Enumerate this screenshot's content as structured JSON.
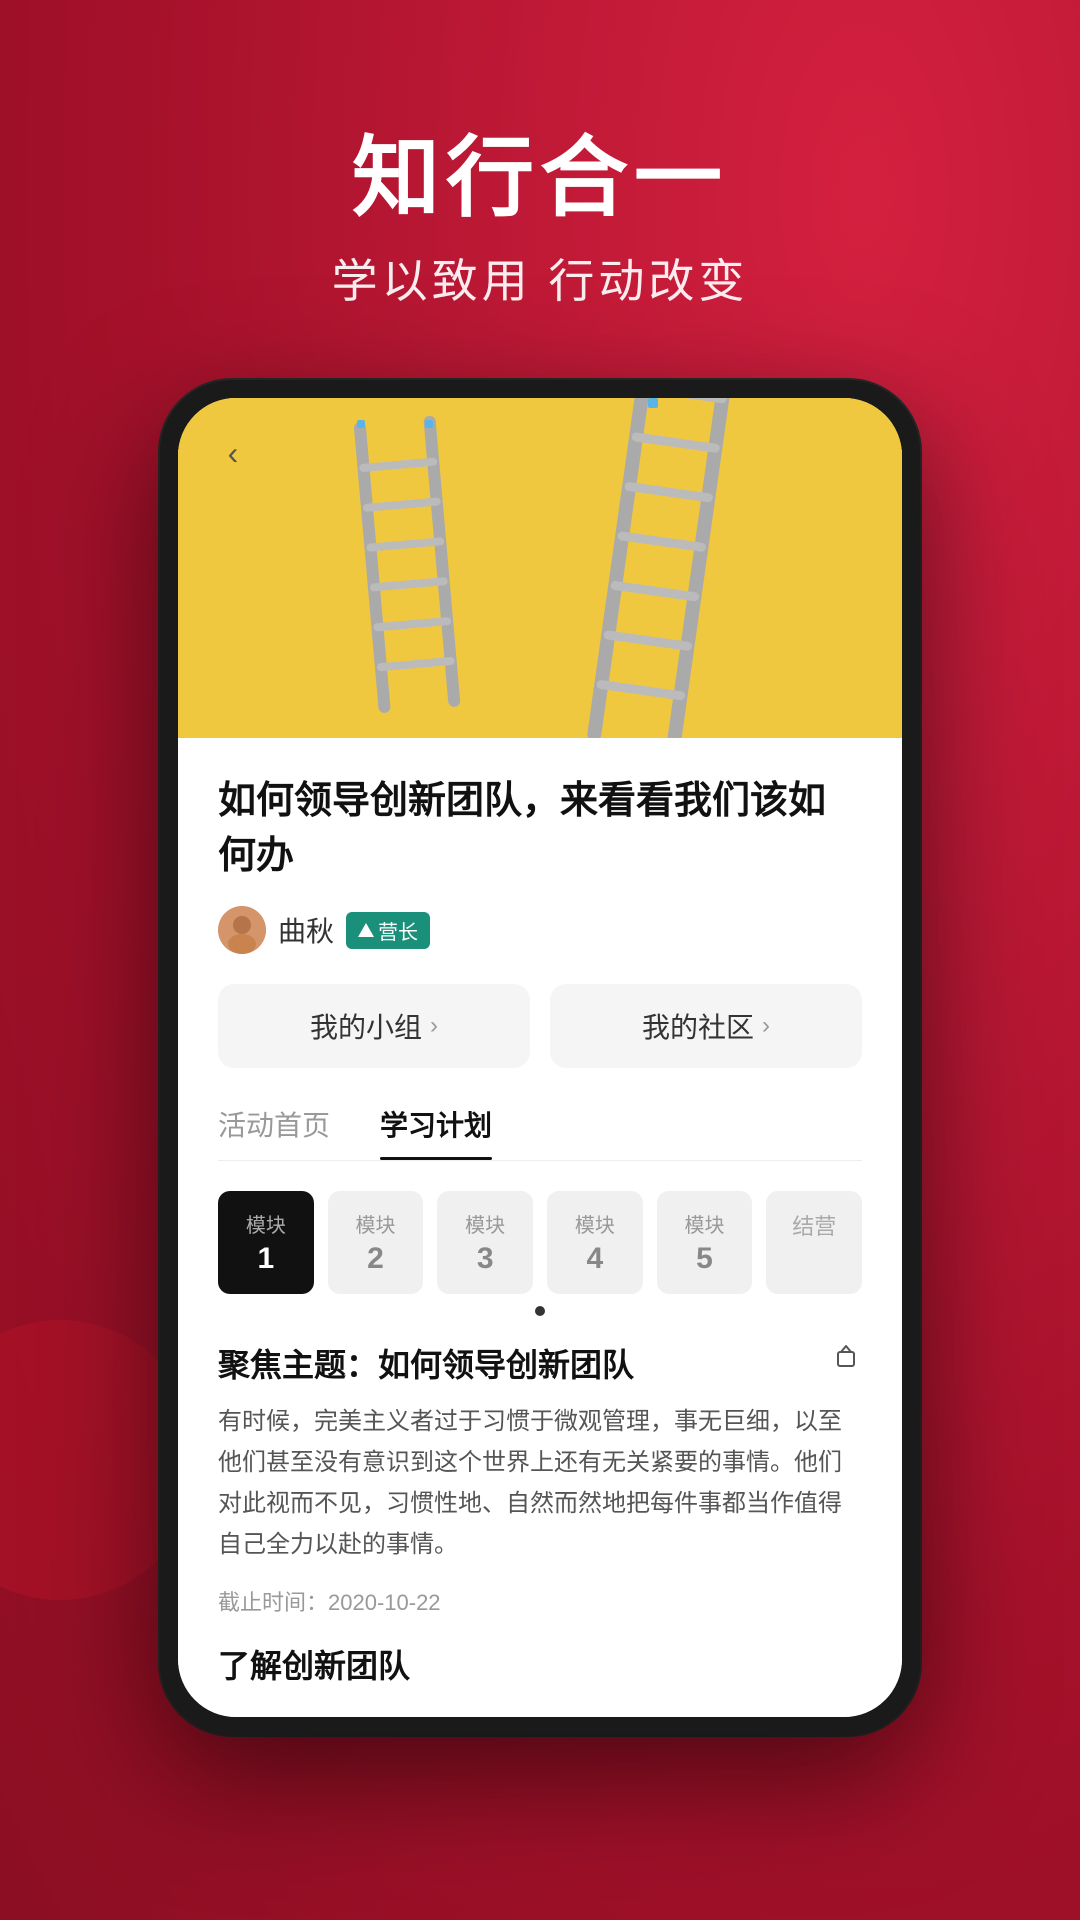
{
  "background": {
    "color": "#c0192d"
  },
  "header": {
    "title": "知行合一",
    "subtitle": "学以致用 行动改变"
  },
  "phone": {
    "article": {
      "back_button": "‹",
      "title": "如何领导创新团队，来看看我们该如何办",
      "author_name": "曲秋",
      "author_badge": "营长",
      "nav_buttons": [
        {
          "label": "我的小组",
          "chevron": "›"
        },
        {
          "label": "我的社区",
          "chevron": "›"
        }
      ],
      "tabs": [
        {
          "label": "活动首页",
          "active": false
        },
        {
          "label": "学习计划",
          "active": true
        }
      ],
      "modules": [
        {
          "label": "模块",
          "number": "1",
          "active": true
        },
        {
          "label": "模块",
          "number": "2",
          "active": false
        },
        {
          "label": "模块",
          "number": "3",
          "active": false
        },
        {
          "label": "模块",
          "number": "4",
          "active": false
        },
        {
          "label": "模块",
          "number": "5",
          "active": false
        },
        {
          "label": "结营",
          "number": "",
          "active": false
        }
      ],
      "section_title": "聚焦主题：如何领导创新团队",
      "section_body": "有时候，完美主义者过于习惯于微观管理，事无巨细，以至他们甚至没有意识到这个世界上还有无关紧要的事情。他们对此视而不见，习惯性地、自然而然地把每件事都当作值得自己全力以赴的事情。",
      "deadline_label": "截止时间：2020-10-22",
      "understand_title": "了解创新团队"
    }
  }
}
